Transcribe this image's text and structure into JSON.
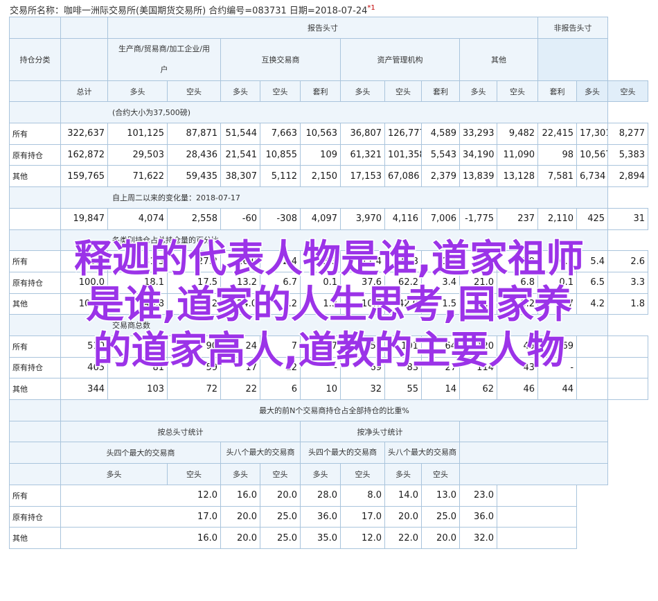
{
  "header": {
    "text": "交易所名称：咖啡一洲际交易所(美国期货交易所)   合约编号=083731   日期=2018-07-24",
    "mark": "*1"
  },
  "table": {
    "title_reportable": "报告头寸",
    "title_nonreportable": "非报告头寸",
    "col_class": "持仓分类",
    "group_producer": "生产商/贸易商/加工企业/用户",
    "group_swap": "互换交易商",
    "group_asset": "资产管理机构",
    "group_other": "其他",
    "sub_total": "总计",
    "sub_long": "多头",
    "sub_short": "空头",
    "sub_spread": "套利",
    "sec1_title": "(合约大小为37,500磅)",
    "sec2_title": "自上周二以来的变化量：2018-07-17",
    "sec3_title": "各类别持仓占总持仓量的百分比",
    "sec4_title": "交易商总数",
    "row_all": "所有",
    "row_old": "原有持仓",
    "row_other": "其他",
    "sec1_rows": [
      {
        "label": "所有",
        "vals": [
          "322,637",
          "101,125",
          "87,871",
          "51,544",
          "7,663",
          "10,563",
          "36,807",
          "126,777",
          "4,589",
          "33,293",
          "9,482",
          "22,415",
          "17,301",
          "8,277"
        ]
      },
      {
        "label": "原有持仓",
        "vals": [
          "162,872",
          "29,503",
          "28,436",
          "21,541",
          "10,855",
          "109",
          "61,321",
          "101,358",
          "5,543",
          "34,190",
          "11,090",
          "98",
          "10,567",
          "5,383"
        ]
      },
      {
        "label": "其他",
        "vals": [
          "159,765",
          "71,622",
          "59,435",
          "38,307",
          "5,112",
          "2,150",
          "17,153",
          "67,086",
          "2,379",
          "13,839",
          "13,128",
          "7,581",
          "6,734",
          "2,894"
        ]
      }
    ],
    "sec2_row": [
      "19,847",
      "4,074",
      "2,558",
      "-60",
      "-308",
      "4,097",
      "3,970",
      "4,116",
      "7,006",
      "-1,775",
      "237",
      "2,110",
      "425",
      "31"
    ],
    "sec3_rows": [
      {
        "label": "所有",
        "vals": [
          "100.0",
          "31.3",
          "27.2",
          "16.0",
          "2.4",
          "3.3",
          "11.4",
          "39.3",
          "1.4",
          "10.3",
          "2.9",
          "6.9",
          "5.4",
          "2.6"
        ]
      },
      {
        "label": "原有持仓",
        "vals": [
          "100.0",
          "18.1",
          "17.5",
          "13.2",
          "6.7",
          "0.1",
          "37.6",
          "62.2",
          "3.4",
          "21.0",
          "6.8",
          "0.1",
          "6.5",
          "3.3"
        ]
      },
      {
        "label": "其他",
        "vals": [
          "100.0",
          "44.8",
          "37.2",
          "24.0",
          "3.2",
          "1.3",
          "10.7",
          "42.0",
          "1.5",
          "8.7",
          "8.2",
          "4.7",
          "4.2",
          "1.8"
        ]
      }
    ],
    "sec4_rows": [
      {
        "label": "所有",
        "vals": [
          "510",
          "118",
          "90",
          "24",
          "7",
          "17",
          "57",
          "101",
          "64",
          "120",
          "45",
          "69",
          "",
          ""
        ]
      },
      {
        "label": "原有持仓",
        "vals": [
          "465",
          "81",
          "59",
          "17",
          "12",
          "-",
          "69",
          "83",
          "27",
          "114",
          "43",
          "-",
          "",
          ""
        ]
      },
      {
        "label": "其他",
        "vals": [
          "344",
          "103",
          "72",
          "22",
          "6",
          "10",
          "32",
          "55",
          "14",
          "62",
          "46",
          "44",
          "",
          ""
        ]
      }
    ],
    "conc_title": "最大的前N个交易商持仓占全部持仓的比重%",
    "conc_gross": "按总头寸统计",
    "conc_net": "按净头寸统计",
    "conc_top4": "头四个最大的交易商",
    "conc_top8": "头八个最大的交易商",
    "conc_rows": [
      {
        "label": "所有",
        "vals": [
          "12.0",
          "16.0",
          "20.0",
          "28.0",
          "8.0",
          "14.0",
          "13.0",
          "23.0"
        ]
      },
      {
        "label": "原有持仓",
        "vals": [
          "17.0",
          "20.0",
          "25.0",
          "36.0",
          "17.0",
          "20.0",
          "25.0",
          "36.0"
        ]
      },
      {
        "label": "其他",
        "vals": [
          "16.0",
          "20.0",
          "25.0",
          "35.0",
          "12.0",
          "22.0",
          "20.0",
          "32.0"
        ]
      }
    ]
  },
  "overlay": {
    "line1": "释迦的代表人物是谁,道家祖师",
    "line2": "是谁,道家的人生思考,国家养",
    "line3": "的道家高人,道教的主要人物"
  }
}
